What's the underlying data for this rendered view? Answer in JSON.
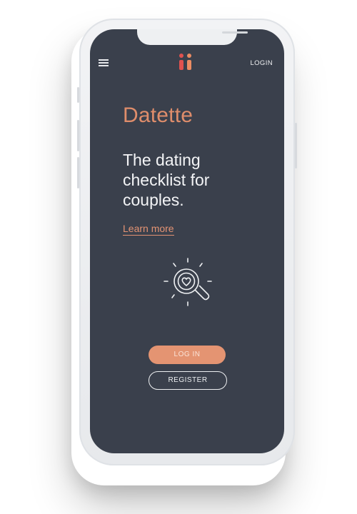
{
  "app": {
    "name": "Datette",
    "tagline": "The dating checklist for couples.",
    "learn_more": "Learn more"
  },
  "header": {
    "login_link": "LOGIN",
    "menu_icon": "hamburger-menu-icon",
    "logo_icon": "ii-logo-icon"
  },
  "illustration": {
    "icon": "magnifier-heart-icon"
  },
  "buttons": {
    "login": "LOG IN",
    "register": "REGISTER"
  },
  "colors": {
    "screen_bg": "#3a404c",
    "accent": "#e49472",
    "logo_red": "#e0524f",
    "logo_orange": "#eb8c63",
    "text_light": "#f3f4f6"
  }
}
